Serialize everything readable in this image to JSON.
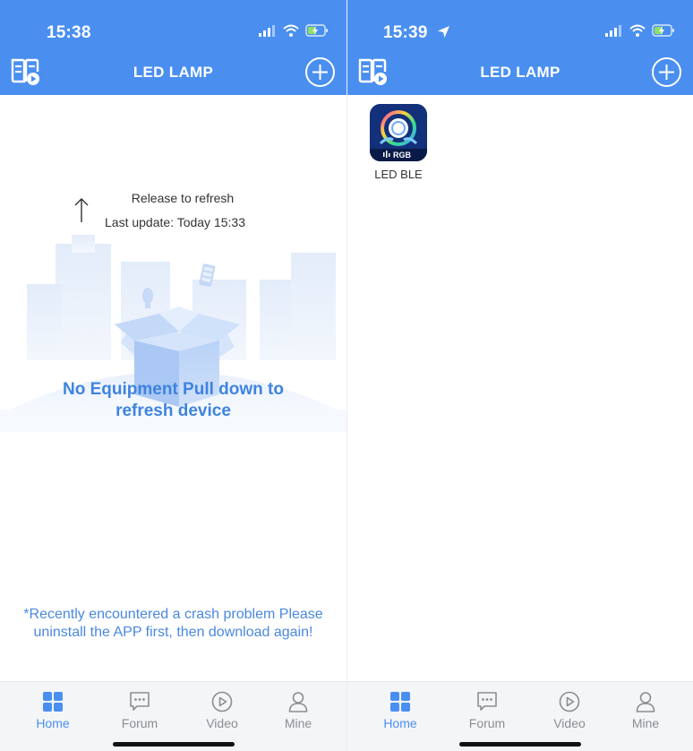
{
  "app": {
    "title": "LED LAMP"
  },
  "screens": {
    "left": {
      "status_time": "15:38",
      "refresh": {
        "release_text": "Release to refresh",
        "last_update": "Last update: Today 15:33"
      },
      "empty_message": "No Equipment  Pull down to refresh device",
      "crash_note": "*Recently encountered a crash problem Please uninstall the APP first, then download again!"
    },
    "right": {
      "status_time": "15:39",
      "devices": [
        {
          "name": "LED BLE",
          "badge": "RGB"
        }
      ]
    }
  },
  "tabs": [
    {
      "label": "Home",
      "icon": "home-grid-icon",
      "active": true
    },
    {
      "label": "Forum",
      "icon": "chat-icon",
      "active": false
    },
    {
      "label": "Video",
      "icon": "play-circle-icon",
      "active": false
    },
    {
      "label": "Mine",
      "icon": "person-icon",
      "active": false
    }
  ],
  "colors": {
    "header": "#4a8ff0",
    "accent": "#3f83e0",
    "tab_inactive": "#8a8d93",
    "tabbar_bg": "#f4f5f7"
  }
}
